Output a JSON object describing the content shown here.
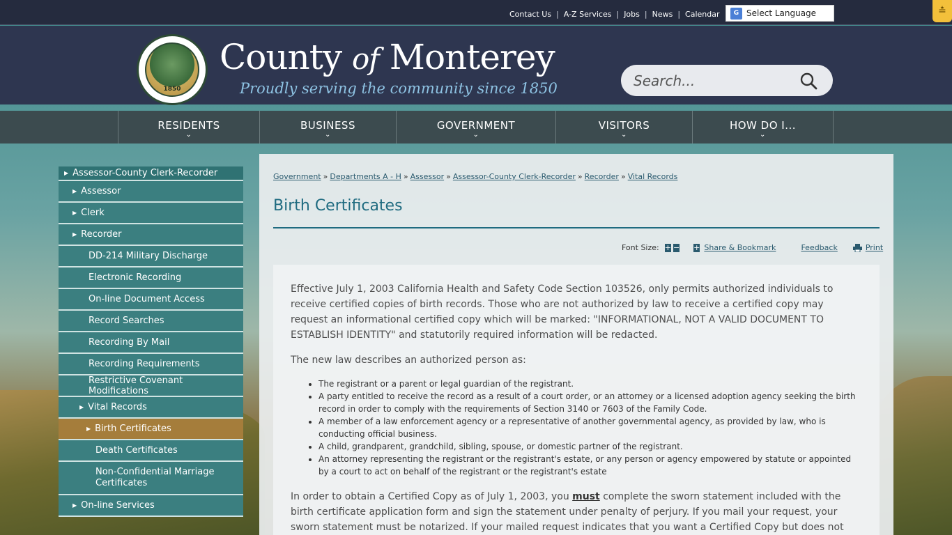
{
  "utility": {
    "links": [
      "Contact Us",
      "A-Z Services",
      "Jobs",
      "News",
      "Calendar"
    ],
    "language_label": "Select Language"
  },
  "header": {
    "seal_text": "1850",
    "title_main": "County",
    "title_of": "of",
    "title_end": "Monterey",
    "tagline": "Proudly serving the community since 1850",
    "search_placeholder": "Search..."
  },
  "nav": {
    "items": [
      "RESIDENTS",
      "BUSINESS",
      "GOVERNMENT",
      "VISITORS",
      "HOW DO I..."
    ]
  },
  "sidebar": {
    "items": [
      {
        "label": "Assessor-County Clerk-Recorder"
      },
      {
        "label": "Assessor"
      },
      {
        "label": "Clerk"
      },
      {
        "label": "Recorder"
      },
      {
        "label": "DD-214 Military Discharge"
      },
      {
        "label": "Electronic Recording"
      },
      {
        "label": "On-line Document Access"
      },
      {
        "label": "Record Searches"
      },
      {
        "label": "Recording By Mail"
      },
      {
        "label": "Recording Requirements"
      },
      {
        "label": "Restrictive Covenant Modifications"
      },
      {
        "label": "Vital Records"
      },
      {
        "label": "Birth Certificates"
      },
      {
        "label": "Death Certificates"
      },
      {
        "label": "Non-Confidential Marriage Certificates"
      },
      {
        "label": "On-line Services"
      }
    ]
  },
  "breadcrumb": [
    "Government",
    "Departments A - H",
    "Assessor",
    "Assessor-County Clerk-Recorder",
    "Recorder",
    "Vital Records"
  ],
  "page": {
    "title": "Birth Certificates",
    "font_size_label": "Font Size:",
    "share_label": "Share & Bookmark",
    "feedback_label": "Feedback",
    "print_label": "Print"
  },
  "article": {
    "p1": "Effective July 1, 2003 California Health and Safety Code Section 103526, only permits authorized individuals to receive certified copies of birth records. Those who are not authorized by law to receive a certified copy may request an informational certified copy which will be marked: \"INFORMATIONAL, NOT A VALID DOCUMENT TO ESTABLISH IDENTITY\" and statutorily required information will be redacted.",
    "p2": "The new law describes an authorized person as:",
    "bullets": [
      "The registrant or a parent or legal guardian of the registrant.",
      "A party entitled to receive the record as a result of a court order, or an attorney or a licensed adoption agency seeking the birth record in order to comply with the requirements of Section 3140 or 7603 of the Family Code.",
      "A member of a law enforcement agency or a representative of another governmental agency, as provided by law, who is conducting official business.",
      "A child, grandparent, grandchild, sibling, spouse, or domestic partner of the registrant.",
      "An attorney representing the registrant or the registrant's estate, or any person or agency empowered by statute or appointed by a court to act on behalf of the registrant or the registrant's estate"
    ],
    "p3_before": "In order to obtain a Certified Copy as of July 1, 2003, you ",
    "p3_must": "must",
    "p3_after": " complete the sworn statement included with the birth certificate application form and sign the statement under penalty of perjury. If you mail your request, your sworn statement must be notarized. If your mailed request indicates that you want a Certified Copy but does not include a"
  }
}
